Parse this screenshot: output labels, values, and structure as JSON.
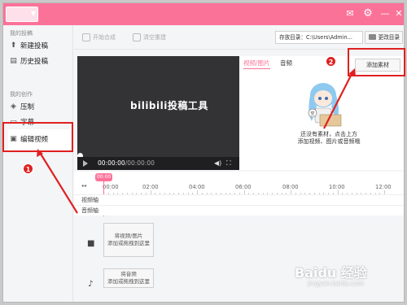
{
  "colors": {
    "accent": "#fb7299",
    "annotation": "#e02020"
  },
  "titlebar": {
    "icons": [
      "mail-icon",
      "gear-icon",
      "minimize-icon",
      "close-icon"
    ]
  },
  "sidebar": {
    "section_submit": "我的投稿",
    "section_create": "我的创作",
    "items": [
      {
        "label": "新建投稿",
        "icon": "upload-icon"
      },
      {
        "label": "历史投稿",
        "icon": "history-icon"
      },
      {
        "label": "压制",
        "icon": "layers-icon"
      },
      {
        "label": "字幕",
        "icon": "subtitle-icon"
      },
      {
        "label": "编辑视频",
        "icon": "edit-video-icon"
      }
    ]
  },
  "toolbar": {
    "start_merge": "开始合成",
    "clear_reset": "清空重建",
    "save_dir": "存放目录：C:\\Users\\Admin...",
    "change_dir": "更改目录"
  },
  "player": {
    "logo": "bilibili投稿工具",
    "time_current": "00:00:00",
    "time_total": "/00:00:00"
  },
  "panel": {
    "tab_video": "视频/图片",
    "tab_audio": "音频",
    "add_button": "添加素材",
    "empty_line1": "还没有素材，点击上方",
    "empty_line2": "添加视频、图片或音频哦"
  },
  "timeline": {
    "playhead": "00:00",
    "ticks": [
      "00:00",
      "02:00",
      "04:00",
      "06:00",
      "08:00",
      "10:00",
      "12:00"
    ],
    "video_track": "视频轴",
    "audio_track": "音频轴",
    "drop_video_line1": "将视频/图片",
    "drop_video_line2": "添加或拖拽到这里",
    "drop_audio_line1": "将音频",
    "drop_audio_line2": "添加或拖拽到这里"
  },
  "annotations": {
    "badge1": "1",
    "badge2": "2"
  },
  "watermark": {
    "line1": "Baidu 经验",
    "line2": "jingyan.baidu.com"
  }
}
